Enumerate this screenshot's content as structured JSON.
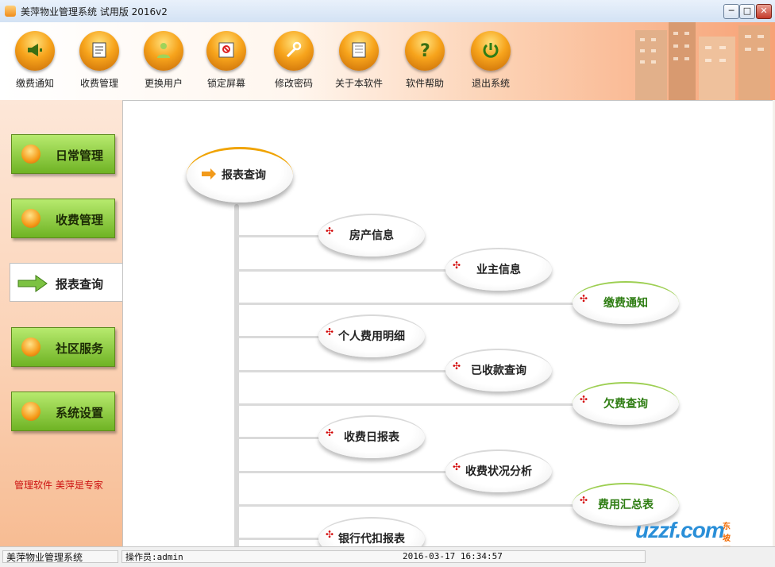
{
  "window": {
    "title": "美萍物业管理系统 试用版 2016v2",
    "controls": {
      "minimize": "─",
      "maximize": "□",
      "close": "✕"
    }
  },
  "toolbar": {
    "items": [
      {
        "label": "缴费通知",
        "icon": "megaphone-icon"
      },
      {
        "label": "收费管理",
        "icon": "document-icon"
      },
      {
        "label": "更换用户",
        "icon": "user-icon"
      },
      {
        "label": "锁定屏幕",
        "icon": "lock-icon"
      },
      {
        "label": "修改密码",
        "icon": "wrench-icon"
      },
      {
        "label": "关于本软件",
        "icon": "info-sheet-icon"
      },
      {
        "label": "软件帮助",
        "icon": "question-icon"
      },
      {
        "label": "退出系统",
        "icon": "power-icon"
      }
    ]
  },
  "sidebar": {
    "items": [
      {
        "label": "日常管理",
        "active": false
      },
      {
        "label": "收费管理",
        "active": false
      },
      {
        "label": "报表查询",
        "active": true
      },
      {
        "label": "社区服务",
        "active": false
      },
      {
        "label": "系统设置",
        "active": false
      }
    ],
    "slogan": "管理软件 美萍是专家"
  },
  "tree": {
    "root": "报表查询",
    "nodes": [
      {
        "label": "房产信息",
        "level": 1,
        "green": false
      },
      {
        "label": "业主信息",
        "level": 2,
        "green": false
      },
      {
        "label": "缴费通知",
        "level": 3,
        "green": true
      },
      {
        "label": "个人费用明细",
        "level": 1,
        "green": false
      },
      {
        "label": "已收款查询",
        "level": 2,
        "green": false
      },
      {
        "label": "欠费查询",
        "level": 3,
        "green": true
      },
      {
        "label": "收费日报表",
        "level": 1,
        "green": false
      },
      {
        "label": "收费状况分析",
        "level": 2,
        "green": false
      },
      {
        "label": "费用汇总表",
        "level": 3,
        "green": true
      },
      {
        "label": "银行代扣报表",
        "level": 1,
        "green": false
      }
    ]
  },
  "statusbar": {
    "app": "美萍物业管理系统",
    "operator": "操作员:admin",
    "datetime": "2016-03-17 16:34:57"
  },
  "watermark": {
    "main": "uzzf.com",
    "tag": "东坡下载"
  }
}
